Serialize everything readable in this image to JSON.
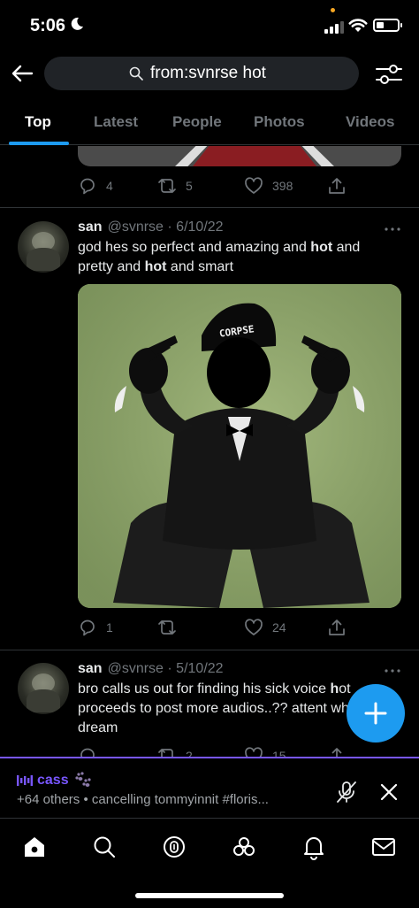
{
  "status_bar": {
    "time": "5:06",
    "battery_level": 0.35
  },
  "search": {
    "query": "from:svnrse hot"
  },
  "tabs": [
    {
      "label": "Top",
      "active": true
    },
    {
      "label": "Latest",
      "active": false
    },
    {
      "label": "People",
      "active": false
    },
    {
      "label": "Photos",
      "active": false
    },
    {
      "label": "Videos",
      "active": false
    }
  ],
  "previous_tweet": {
    "replies": "4",
    "retweets": "5",
    "likes": "398"
  },
  "tweets": [
    {
      "name": "san",
      "handle": "@svnrse",
      "date": "· 6/10/22",
      "text_html": "god hes so perfect and amazing and <b>hot</b> and pretty and <b>hot</b> and smart",
      "media_text": "CORPSE",
      "replies": "1",
      "retweets": "",
      "likes": "24"
    },
    {
      "name": "san",
      "handle": "@svnrse",
      "date": "· 5/10/22",
      "text_html": "bro calls us out for finding his sick voice <b>h</b>ot proceeds to post more audios..?? attent whore dream",
      "replies": "",
      "retweets": "2",
      "likes": "15"
    }
  ],
  "space": {
    "host": "cass",
    "meta": "+64 others • cancelling tommyinnit #floris..."
  },
  "colors": {
    "accent": "#1d9bf0",
    "spaces": "#7856ff",
    "muted": "#71767b"
  }
}
